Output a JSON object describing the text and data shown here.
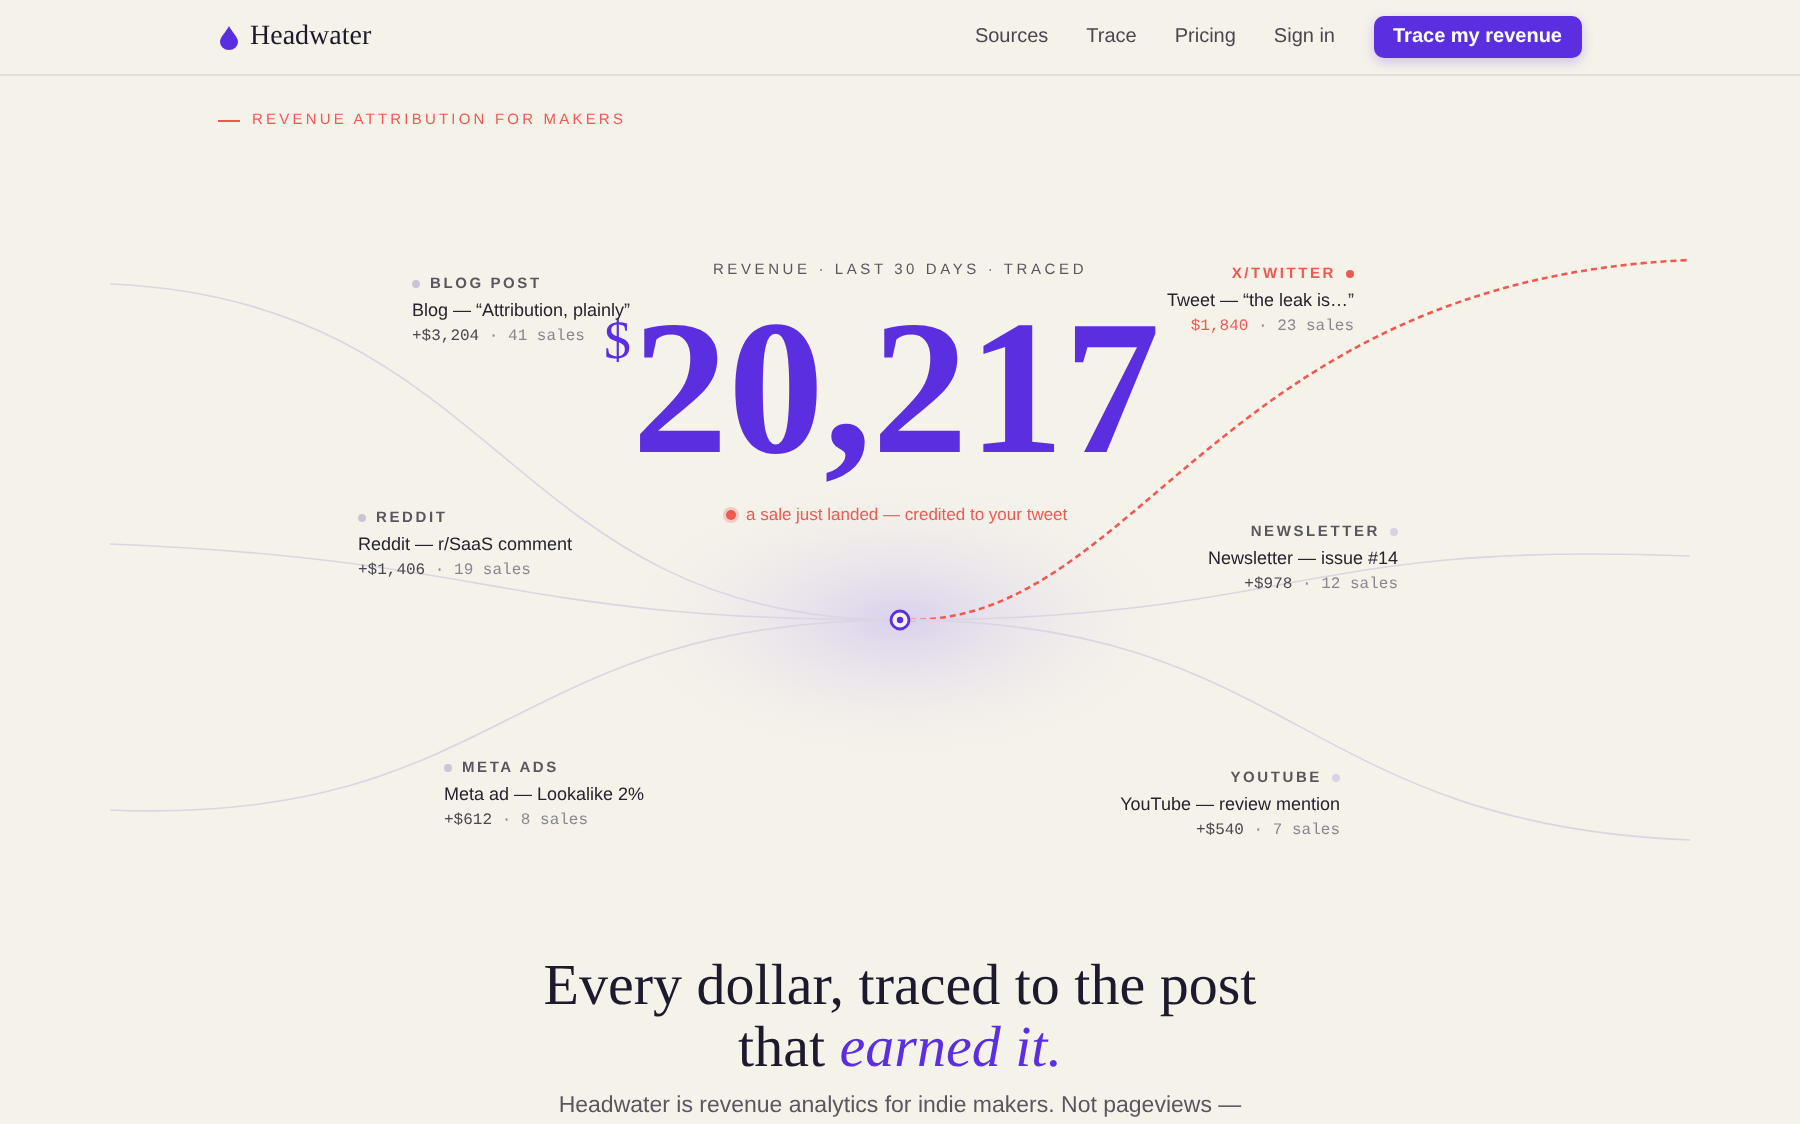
{
  "nav": {
    "brand": "Headwater",
    "links": [
      "Sources",
      "Trace",
      "Pricing",
      "Sign in"
    ],
    "cta": "Trace my revenue"
  },
  "eyebrow": "REVENUE ATTRIBUTION FOR MAKERS",
  "hero": {
    "caption": "REVENUE · LAST 30 DAYS · TRACED",
    "currency": "$",
    "total": "20,217",
    "note": "a sale just landed — credited to your tweet",
    "sources": [
      {
        "label": "BLOG POST",
        "title": "Blog — “Attribution, plainly”",
        "amount": "+$3,204",
        "sales": "· 41 sales",
        "color": "#c9c4d6",
        "active": false
      },
      {
        "label": "REDDIT",
        "title": "Reddit — r/SaaS comment",
        "amount": "+$1,406",
        "sales": "· 19 sales",
        "color": "#c9c4d6",
        "active": false
      },
      {
        "label": "META ADS",
        "title": "Meta ad — Lookalike 2%",
        "amount": "+$612",
        "sales": "· 8 sales",
        "color": "#c9c4d6",
        "active": false
      },
      {
        "label": "X/TWITTER",
        "title": "Tweet — “the leak is…”",
        "amount": "$1,840",
        "sales": "· 23 sales",
        "color": "#ef5a50",
        "active": true
      },
      {
        "label": "NEWSLETTER",
        "title": "Newsletter — issue #14",
        "amount": "+$978",
        "sales": "· 12 sales",
        "color": "#d6d2e4",
        "active": false
      },
      {
        "label": "YOUTUBE",
        "title": "YouTube — review mention",
        "amount": "+$540",
        "sales": "· 7 sales",
        "color": "#d6d2e4",
        "active": false
      }
    ]
  },
  "headline": "Every dollar, traced to the post that *earned it.*",
  "subtext": "Headwater is revenue analytics for indie makers. Not pageviews —"
}
